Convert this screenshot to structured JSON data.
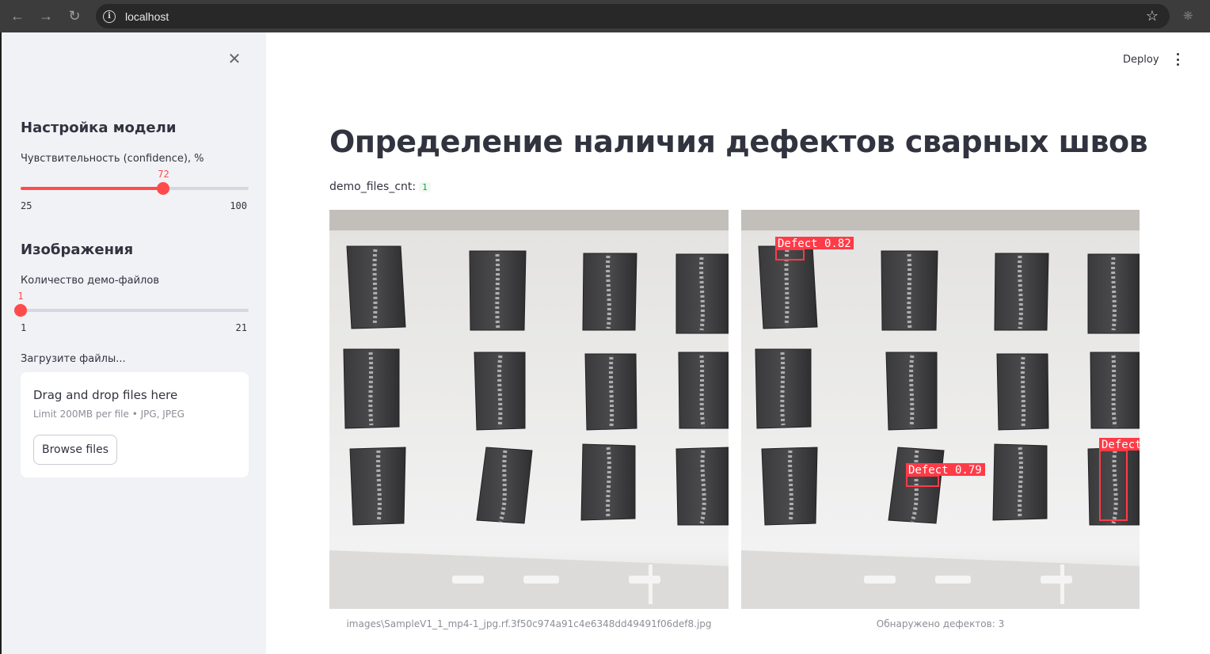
{
  "browser": {
    "url": "localhost"
  },
  "sidebar": {
    "model_heading": "Настройка модели",
    "confidence": {
      "label": "Чувствительность (confidence), %",
      "value": 72,
      "min": 25,
      "max": 100
    },
    "images_heading": "Изображения",
    "demo_count": {
      "label": "Количество демо-файлов",
      "value": 1,
      "min": 1,
      "max": 21
    },
    "upload": {
      "label": "Загрузите файлы...",
      "drag_text": "Drag and drop files here",
      "limit_text": "Limit 200MB per file • JPG, JPEG",
      "browse_label": "Browse files"
    }
  },
  "header": {
    "deploy_label": "Deploy"
  },
  "main": {
    "title": "Определение наличия дефектов сварных швов",
    "metric_label": "demo_files_cnt:",
    "metric_value": "1",
    "left_caption": "images\\SampleV1_1_mp4-1_jpg.rf.3f50c974a91c4e6348dd49491f06def8.jpg",
    "right_caption": "Обнаружено дефектов: 3",
    "detections": [
      {
        "label": "Defect 0.82"
      },
      {
        "label": "Defect 0.79"
      },
      {
        "label": "Defect"
      }
    ]
  },
  "colors": {
    "accent": "#ff4b4b",
    "sidebar_bg": "#f0f2f6",
    "text": "#31333f",
    "detection_box": "#ff3b47"
  }
}
